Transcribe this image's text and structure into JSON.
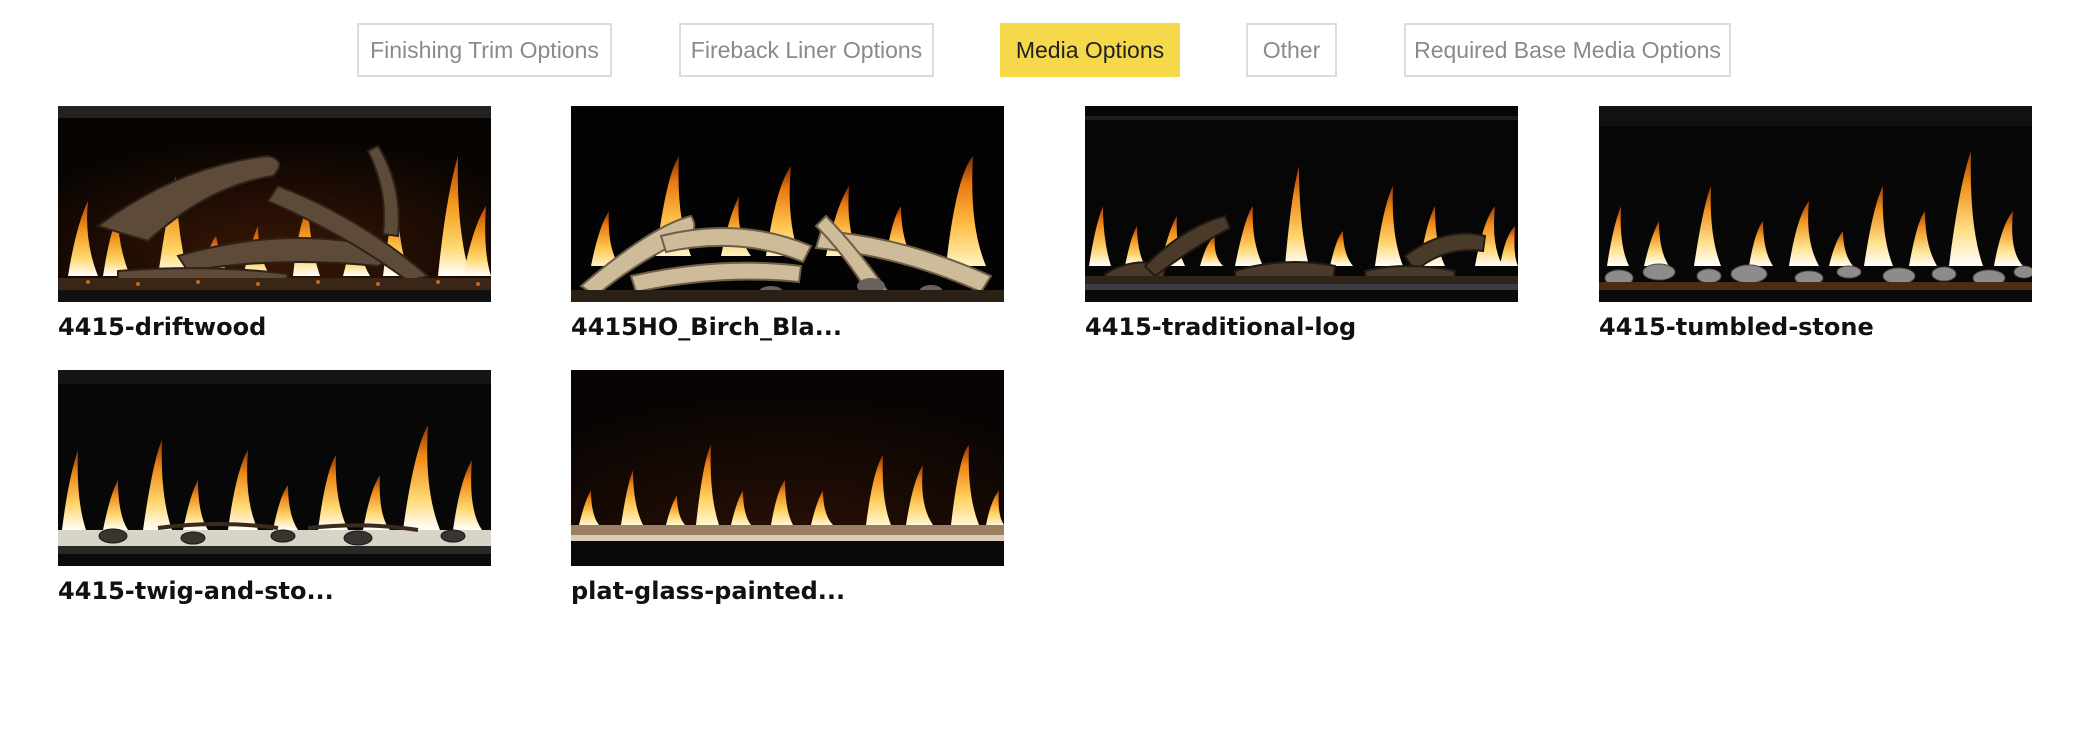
{
  "tabs": [
    {
      "label": "Finishing Trim Options",
      "active": false
    },
    {
      "label": "Fireback Liner Options",
      "active": false
    },
    {
      "label": "Media Options",
      "active": true
    },
    {
      "label": "Other",
      "active": false
    },
    {
      "label": "Required Base Media Options",
      "active": false
    }
  ],
  "gallery": [
    {
      "title": "4415-driftwood",
      "media": "driftwood"
    },
    {
      "title": "4415HO_Birch_Bla...",
      "media": "birch-logs"
    },
    {
      "title": "4415-traditional-log",
      "media": "traditional-log"
    },
    {
      "title": "4415-tumbled-stone",
      "media": "tumbled-stone"
    },
    {
      "title": "4415-twig-and-sto...",
      "media": "twig-and-stone"
    },
    {
      "title": "plat-glass-painted...",
      "media": "glass"
    }
  ],
  "colors": {
    "active_tab": "#f6d84b",
    "tab_border": "#dcdcdc",
    "tab_text": "#8a8a8a"
  }
}
